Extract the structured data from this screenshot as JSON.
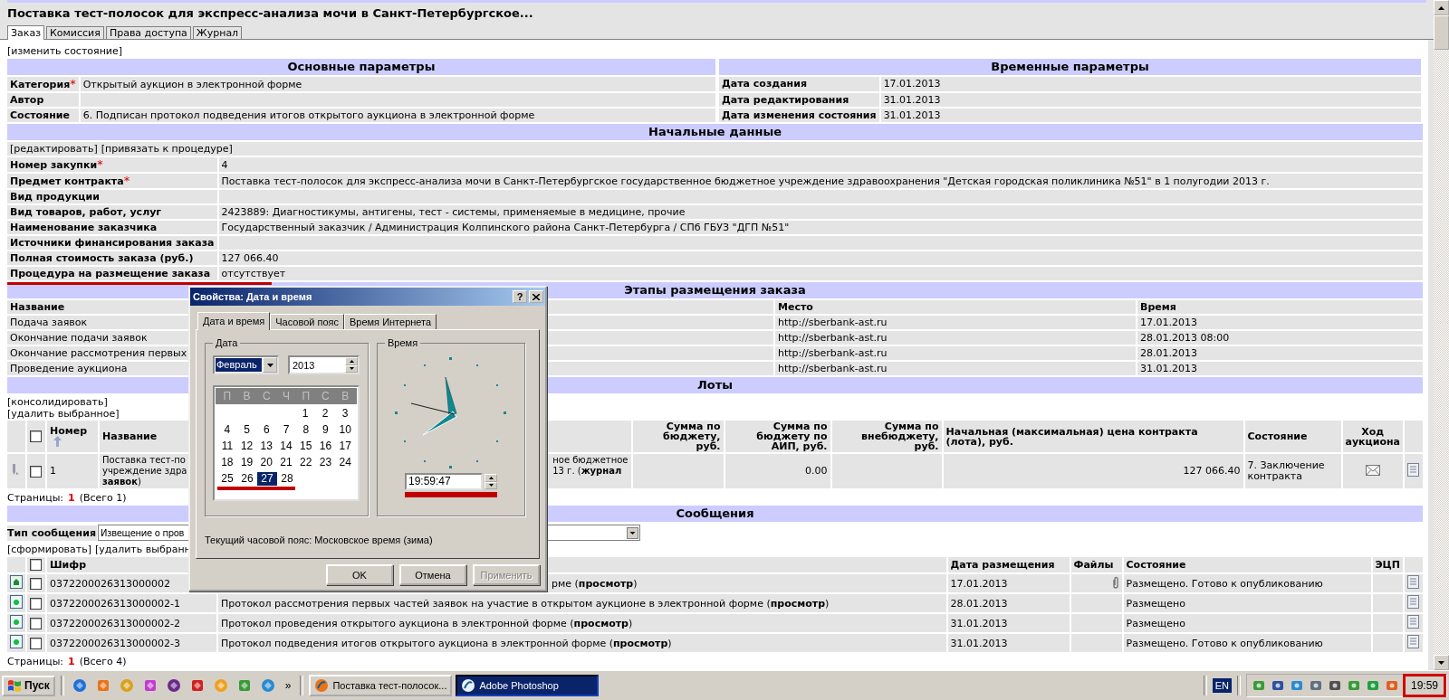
{
  "page_title": "Поставка тест-полосок для экспресс-анализа мочи в Санкт-Петербургское...",
  "tabs": [
    {
      "label": "Заказ",
      "selected": true
    },
    {
      "label": "Комиссия",
      "selected": false
    },
    {
      "label": "Права доступа",
      "selected": false
    },
    {
      "label": "Журнал",
      "selected": false
    }
  ],
  "change_state_link": "[изменить состояние]",
  "basic_params": {
    "title": "Основные параметры",
    "rows": [
      {
        "label": "Категория",
        "required_mark": "*",
        "value": "Открытый аукцион в электронной форме"
      },
      {
        "label": "Автор"
      },
      {
        "label": "Состояние",
        "value": "6. Подписан протокол подведения итогов открытого аукциона в электронной форме"
      }
    ]
  },
  "time_params": {
    "title": "Временные параметры",
    "rows": [
      {
        "label": "Дата создания",
        "value": "17.01.2013"
      },
      {
        "label": "Дата редактирования",
        "value": "31.01.2013"
      },
      {
        "label": "Дата изменения состояния",
        "value": "31.01.2013"
      }
    ]
  },
  "initial_data": {
    "title": "Начальные данные",
    "links": [
      "[редактировать]",
      "[привязать к процедуре]"
    ],
    "rows": [
      {
        "label": "Номер закупки",
        "required_mark": "*",
        "value": "4",
        "marked": false
      },
      {
        "label": "Предмет контракта",
        "required_mark": "*",
        "value": "Поставка тест-полосок для экспресс-анализа мочи в Санкт-Петербургское государственное бюджетное учреждение здравоохранения \"Детская городская поликлиника №51\" в 1 полугодии 2013 г.",
        "marked": false
      },
      {
        "label": "Вид продукции",
        "marked": false
      },
      {
        "label": "Вид товаров, работ, услуг",
        "value": "2423889: Диагностикумы, антигены, тест - системы, применяемые в медицине, прочие",
        "marked": false
      },
      {
        "label": "Наименование заказчика",
        "value": "Государственный заказчик / Администрация Колпинского района Санкт-Петербурга / СПб ГБУЗ \"ДГП №51\"",
        "marked": false
      },
      {
        "label": "Источники финансирования заказа",
        "marked": false
      },
      {
        "label": "Полная стоимость заказа (руб.)",
        "value": "127 066.40",
        "marked": false
      },
      {
        "label": "Процедура на размещение заказа",
        "value": "отсутствует",
        "marked": true
      }
    ]
  },
  "stages": {
    "title": "Этапы размещения заказа",
    "columns": [
      "Название",
      "Место",
      "Время"
    ],
    "rows": [
      [
        "Подача заявок",
        "http://sberbank-ast.ru",
        "17.01.2013"
      ],
      [
        "Окончание подачи заявок",
        "http://sberbank-ast.ru",
        "28.01.2013 08:00"
      ],
      [
        "Окончание рассмотрения первых",
        "http://sberbank-ast.ru",
        "28.01.2013"
      ],
      [
        "Проведение аукциона",
        "http://sberbank-ast.ru",
        "31.01.2013"
      ]
    ]
  },
  "lots": {
    "title": "Лоты",
    "links": [
      "[консолидировать]",
      "[удалить выбранное]"
    ],
    "header_checked": false,
    "columns": [
      "Номер",
      "Название",
      "Сумма по бюджету, руб.",
      "Сумма по бюджету по АИП, руб.",
      "Сумма по внебюджету, руб.",
      "Начальная (максимальная) цена контракта (лота), руб.",
      "Состояние",
      "Ход аукциона"
    ],
    "rows": [
      {
        "checked": false,
        "number": "1",
        "name_left": [
          "Поставка тест-по",
          "учреждение здра",
          "**заявок**)"
        ],
        "name_right": [
          "ное бюджетное",
          "13 г. (**журнал**"
        ],
        "aip": "0.00",
        "price": "127 066.40",
        "state": "7. Заключение контракта"
      }
    ],
    "pager": {
      "label": "Страницы:",
      "current": "1",
      "total": "(Всего 1)"
    }
  },
  "messages": {
    "title": "Сообщения",
    "type_label": "Тип сообщения",
    "type_value": "Извещение о пров",
    "links": [
      "[сформировать]",
      "[удалить выбранн"
    ],
    "header_checked": false,
    "columns": [
      "Шифр",
      "Дата размещения",
      "Файлы",
      "Состояние",
      "ЭЦП"
    ],
    "rows": [
      {
        "kind": "signed",
        "checked": false,
        "code": "0372200026313000002",
        "description": "рме (**просмотр**)",
        "partly_hidden": true,
        "date": "17.01.2013",
        "has_file": true,
        "state": "Размещено. Готово к опубликованию"
      },
      {
        "kind": "dot",
        "checked": false,
        "code": "0372200026313000002-1",
        "description": "Протокол рассмотрения первых частей заявок на участие в открытом аукционе в электронной форме (**просмотр**)",
        "partly_hidden": false,
        "date": "28.01.2013",
        "has_file": false,
        "state": "Размещено"
      },
      {
        "kind": "dot",
        "checked": false,
        "code": "0372200026313000002-2",
        "description": "Протокол проведения открытого аукциона в электронной форме (**просмотр**)",
        "partly_hidden": false,
        "date": "31.01.2013",
        "has_file": false,
        "state": "Размещено"
      },
      {
        "kind": "dot",
        "checked": false,
        "code": "0372200026313000002-3",
        "description": "Протокол подведения итогов открытого аукциона в электронной форме (**просмотр**)",
        "partly_hidden": false,
        "date": "31.01.2013",
        "has_file": false,
        "state": "Размещено. Готово к опубликованию"
      }
    ],
    "pager": {
      "label": "Страницы:",
      "current": "1",
      "total": "(Всего 4)"
    }
  },
  "dialog": {
    "title": "Свойства: Дата и время",
    "help_button": "?",
    "tabs": [
      {
        "label": "Дата и время",
        "selected": true
      },
      {
        "label": "Часовой пояс",
        "selected": false
      },
      {
        "label": "Время Интернета",
        "selected": false
      }
    ],
    "date_group": "Дата",
    "month": "Февраль",
    "year": "2013",
    "weekdays": [
      "П",
      "В",
      "С",
      "Ч",
      "П",
      "С",
      "В"
    ],
    "weeks": [
      {
        "marked": false,
        "kind": "end",
        "days": [
          {
            "d": "1",
            "selected": false
          },
          {
            "d": "2",
            "selected": false
          },
          {
            "d": "3",
            "selected": false
          }
        ]
      },
      {
        "marked": false,
        "days": [
          {
            "d": "4",
            "selected": false
          },
          {
            "d": "5",
            "selected": false
          },
          {
            "d": "6",
            "selected": false
          },
          {
            "d": "7",
            "selected": false
          },
          {
            "d": "8",
            "selected": false
          },
          {
            "d": "9",
            "selected": false
          },
          {
            "d": "10",
            "selected": false
          }
        ]
      },
      {
        "marked": false,
        "days": [
          {
            "d": "11",
            "selected": false
          },
          {
            "d": "12",
            "selected": false
          },
          {
            "d": "13",
            "selected": false
          },
          {
            "d": "14",
            "selected": false
          },
          {
            "d": "15",
            "selected": false
          },
          {
            "d": "16",
            "selected": false
          },
          {
            "d": "17",
            "selected": false
          }
        ]
      },
      {
        "marked": false,
        "days": [
          {
            "d": "18",
            "selected": false
          },
          {
            "d": "19",
            "selected": false
          },
          {
            "d": "20",
            "selected": false
          },
          {
            "d": "21",
            "selected": false
          },
          {
            "d": "22",
            "selected": false
          },
          {
            "d": "23",
            "selected": false
          },
          {
            "d": "24",
            "selected": false
          }
        ]
      },
      {
        "marked": true,
        "kind": "start",
        "days": [
          {
            "d": "25",
            "selected": false
          },
          {
            "d": "26",
            "selected": false
          },
          {
            "d": "27",
            "selected": true
          },
          {
            "d": "28",
            "selected": false
          }
        ]
      }
    ],
    "time_group": "Время",
    "time": "19:59:47",
    "time_marked": true,
    "timezone": "Текущий часовой пояс: Московское время (зима)",
    "buttons": [
      {
        "label": "OK",
        "disabled": false
      },
      {
        "label": "Отмена",
        "disabled": false
      },
      {
        "label": "Применить",
        "disabled": true
      }
    ]
  },
  "taskbar": {
    "start": "Пуск",
    "more": "»",
    "tasks": [
      {
        "label": "Поставка тест-полосок...",
        "selected": false
      },
      {
        "label": "Adobe Photoshop",
        "selected": true
      }
    ],
    "language": "EN",
    "clock": "19:59",
    "clock_marked": true
  }
}
